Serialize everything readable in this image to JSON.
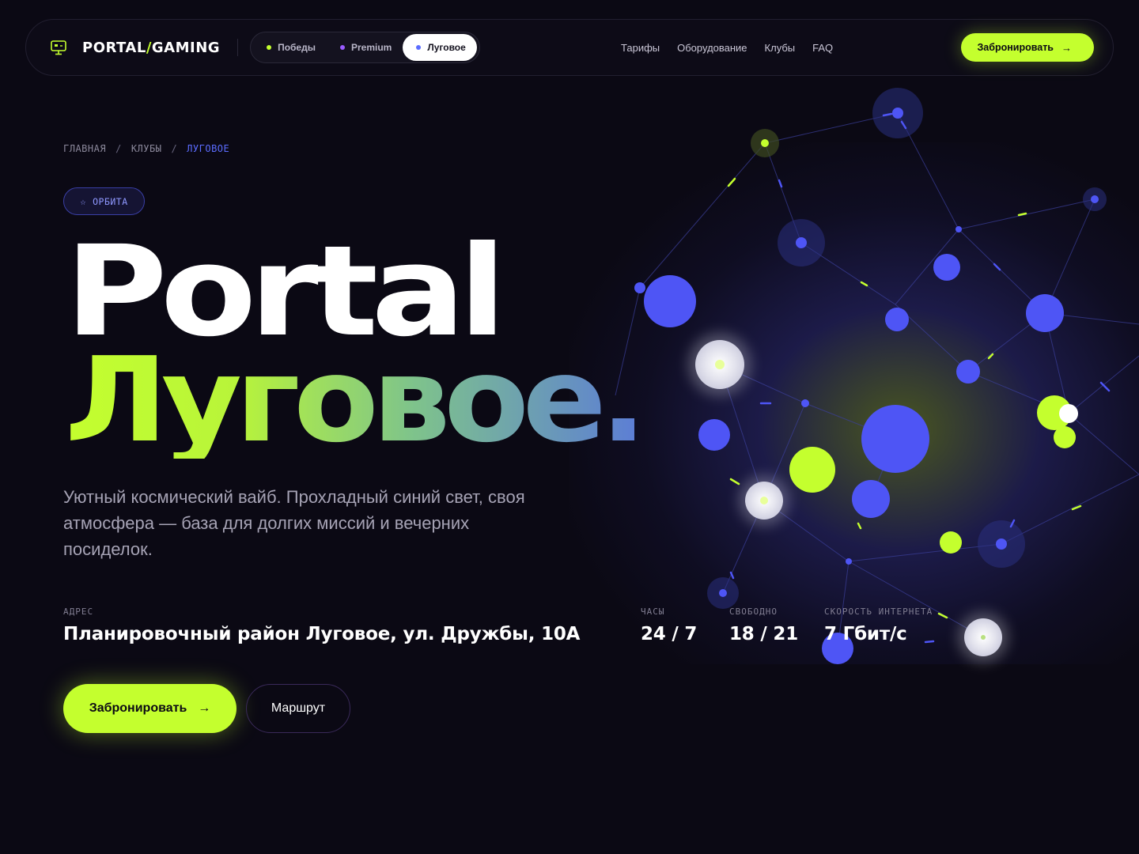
{
  "brand": {
    "name_left": "PORTAL",
    "slash": "/",
    "name_right": "GAMING"
  },
  "club_tabs": [
    {
      "label": "Победы",
      "dot_color": "#c4ff2e",
      "active": false
    },
    {
      "label": "Premium",
      "dot_color": "#9a5cff",
      "active": false
    },
    {
      "label": "Луговое",
      "dot_color": "#5b6cff",
      "active": true
    }
  ],
  "nav": [
    "Тарифы",
    "Оборудование",
    "Клубы",
    "FAQ"
  ],
  "header_cta": {
    "label": "Забронировать",
    "arrow": "→"
  },
  "breadcrumb": {
    "items": [
      "ГЛАВНАЯ",
      "КЛУБЫ",
      "ЛУГОВОЕ"
    ],
    "separator": "/"
  },
  "badge": {
    "icon": "star-icon",
    "label": "ОРБИТА"
  },
  "hero": {
    "title_line1": "Portal",
    "title_line2": "Луговое.",
    "description": "Уютный космический вайб. Прохладный синий свет, своя атмосфера — база для долгих миссий и вечерних посиделок."
  },
  "stats": {
    "address": {
      "label": "АДРЕС",
      "value": "Планировочный район Луговое, ул. Дружбы, 10А"
    },
    "hours": {
      "label": "ЧАСЫ",
      "value": "24 / 7"
    },
    "free": {
      "label": "СВОБОДНО",
      "value": "18 / 21"
    },
    "speed": {
      "label": "СКОРОСТЬ ИНТЕРНЕТА",
      "value": "7 Гбит/с"
    }
  },
  "actions": {
    "primary": {
      "label": "Забронировать",
      "arrow": "→"
    },
    "secondary": {
      "label": "Маршрут"
    }
  },
  "colors": {
    "accent": "#c4ff2e",
    "blue": "#5b6cff",
    "background": "#0b0914"
  }
}
